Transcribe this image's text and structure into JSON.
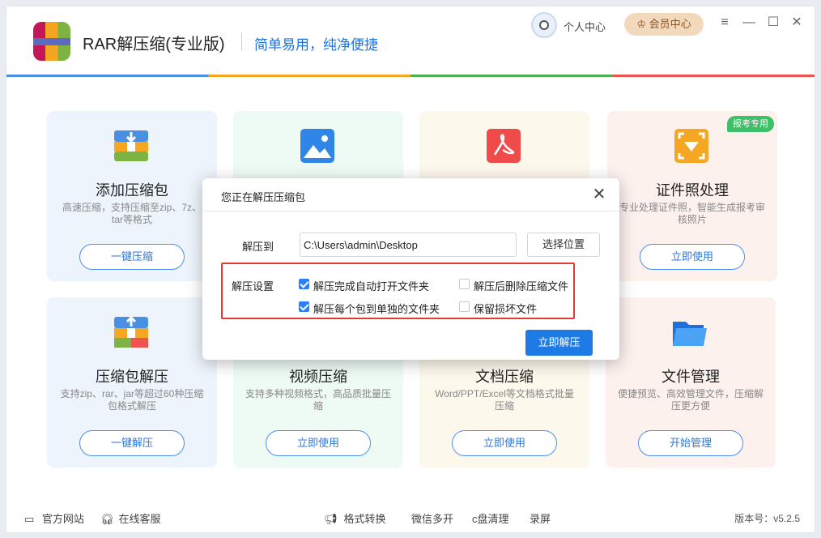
{
  "app": {
    "title": "RAR解压缩(专业版)",
    "slogan": "简单易用，纯净便捷",
    "personal_center": "个人中心",
    "vip_center": "会员中心"
  },
  "colors": {
    "accent": "#1e7be6",
    "badge": "#3fbf6a",
    "highlight_border": "#e53935"
  },
  "cards": [
    {
      "title": "添加压缩包",
      "desc": "高速压缩，支持压缩至zip、7z、tar等格式",
      "button": "一键压缩",
      "icon": "archive-add-icon"
    },
    {
      "title": "",
      "desc": "",
      "button": "",
      "icon": "image-icon"
    },
    {
      "title": "",
      "desc": "",
      "button": "",
      "icon": "pdf-icon"
    },
    {
      "title": "证件照处理",
      "desc": "专业处理证件照，智能生成报考审核照片",
      "button": "立即使用",
      "badge": "报考专用",
      "icon": "id-photo-icon"
    },
    {
      "title": "压缩包解压",
      "desc": "支持zip、rar、jar等超过60种压缩包格式解压",
      "button": "一键解压",
      "icon": "archive-extract-icon"
    },
    {
      "title": "视频压缩",
      "desc": "支持多种视频格式，高品质批量压缩",
      "button": "立即使用",
      "icon": "video-icon"
    },
    {
      "title": "文档压缩",
      "desc": "Word/PPT/Excel等文档格式批量压缩",
      "button": "立即使用",
      "icon": "document-icon"
    },
    {
      "title": "文件管理",
      "desc": "便捷预览、高效管理文件，压缩解压更方便",
      "button": "开始管理",
      "icon": "folder-icon"
    }
  ],
  "dialog": {
    "title": "您正在解压压缩包",
    "extract_to_label": "解压到",
    "path": "C:\\Users\\admin\\Desktop",
    "choose_button": "选择位置",
    "settings_label": "解压设置",
    "options": [
      {
        "label": "解压完成自动打开文件夹",
        "checked": true
      },
      {
        "label": "解压后删除压缩文件",
        "checked": false
      },
      {
        "label": "解压每个包到单独的文件夹",
        "checked": true
      },
      {
        "label": "保留损坏文件",
        "checked": false
      }
    ],
    "extract_button": "立即解压"
  },
  "footer": {
    "website": "官方网站",
    "support": "在线客服",
    "format_convert": "格式转换",
    "wechat_multi": "微信多开",
    "c_clean": "c盘清理",
    "record": "录屏",
    "version": "版本号：v5.2.5"
  }
}
